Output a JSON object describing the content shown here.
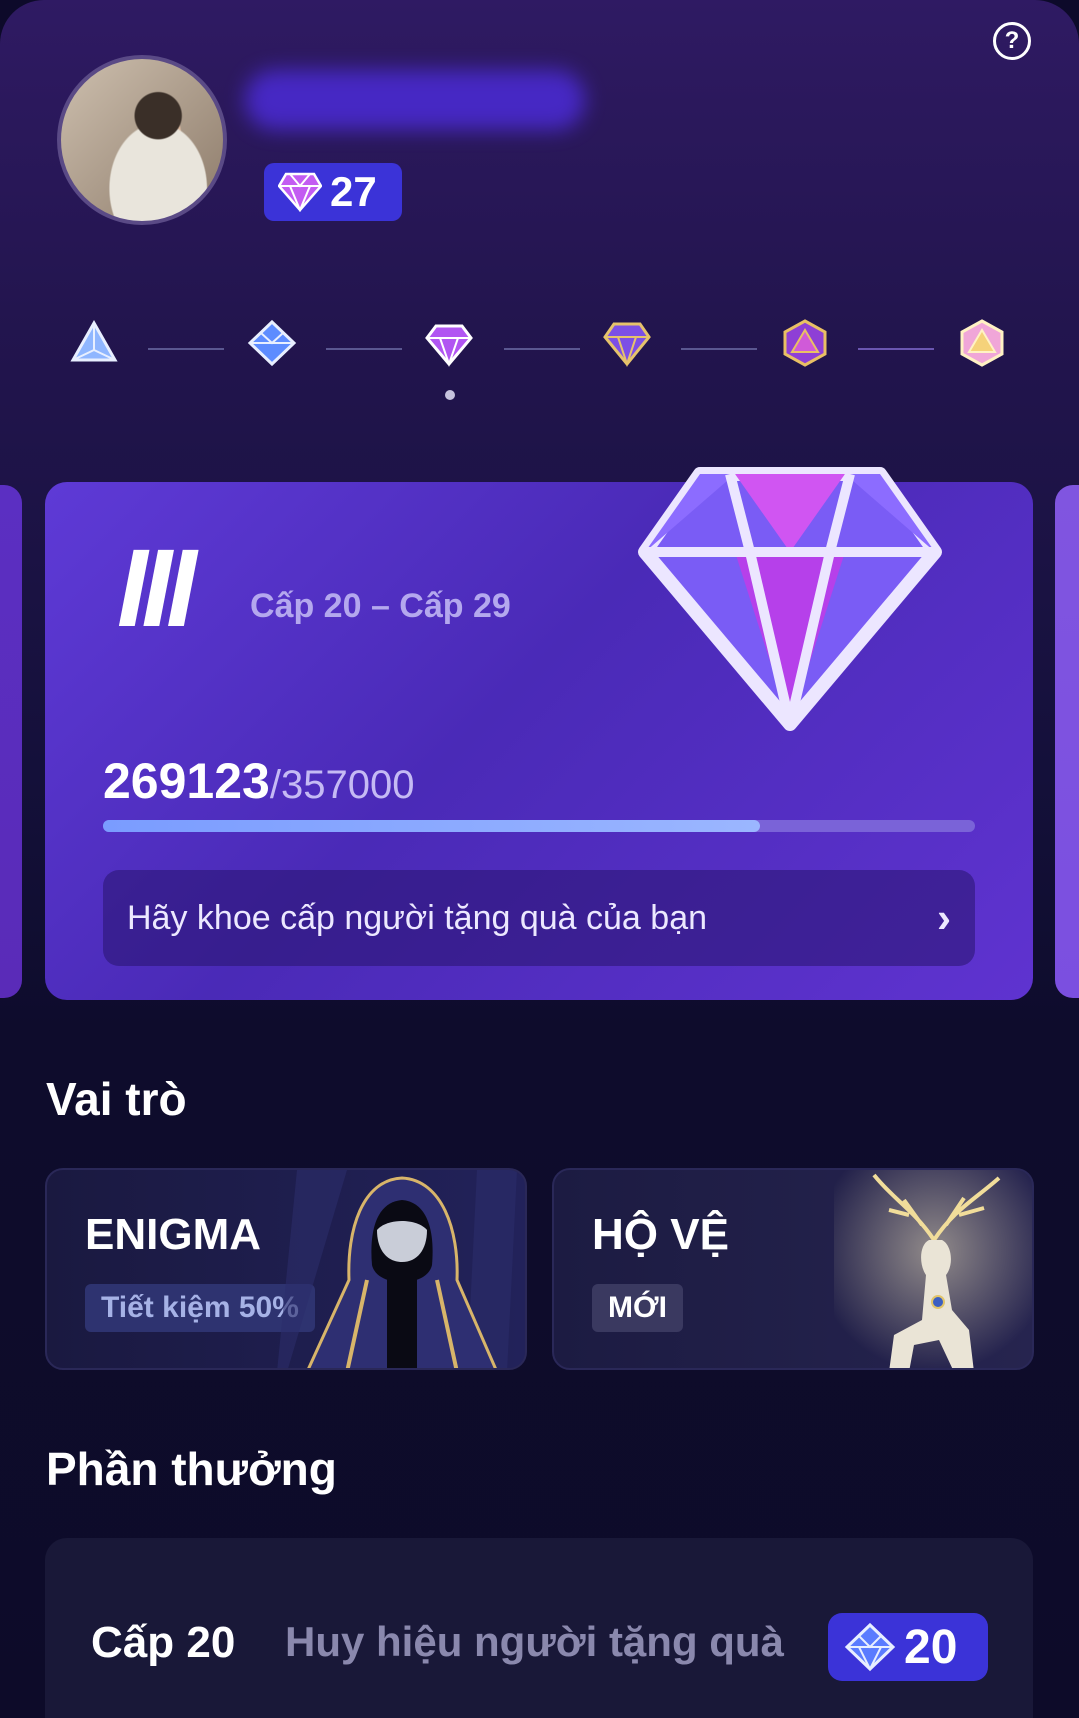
{
  "header": {
    "gem_count": "27",
    "help_symbol": "?"
  },
  "levels": {
    "icons": [
      "tier-1-icon",
      "tier-2-icon",
      "tier-3-icon",
      "tier-4-icon",
      "tier-5-icon",
      "tier-6-icon"
    ],
    "selected_index": 2
  },
  "card": {
    "tier_numeral": "III",
    "level_range": "Cấp 20 – Cấp 29",
    "current_points": "269123",
    "total_points": "/357000",
    "progress": 0.754,
    "cta_label": "Hãy khoe cấp người tặng quà của bạn",
    "cta_chevron": "›"
  },
  "roles_section": {
    "title": "Vai trò",
    "items": [
      {
        "title": "ENIGMA",
        "tag": "Tiết kiệm 50%"
      },
      {
        "title": "HỘ VỆ",
        "tag": "MỚI"
      }
    ]
  },
  "rewards_section": {
    "title": "Phần thưởng",
    "item": {
      "level": "Cấp 20",
      "description": "Huy hiệu người tặng quà",
      "badge_count": "20"
    }
  },
  "colors": {
    "accent": "#3b33d8",
    "card": "#5e3ad6",
    "background": "#0d0b29"
  }
}
